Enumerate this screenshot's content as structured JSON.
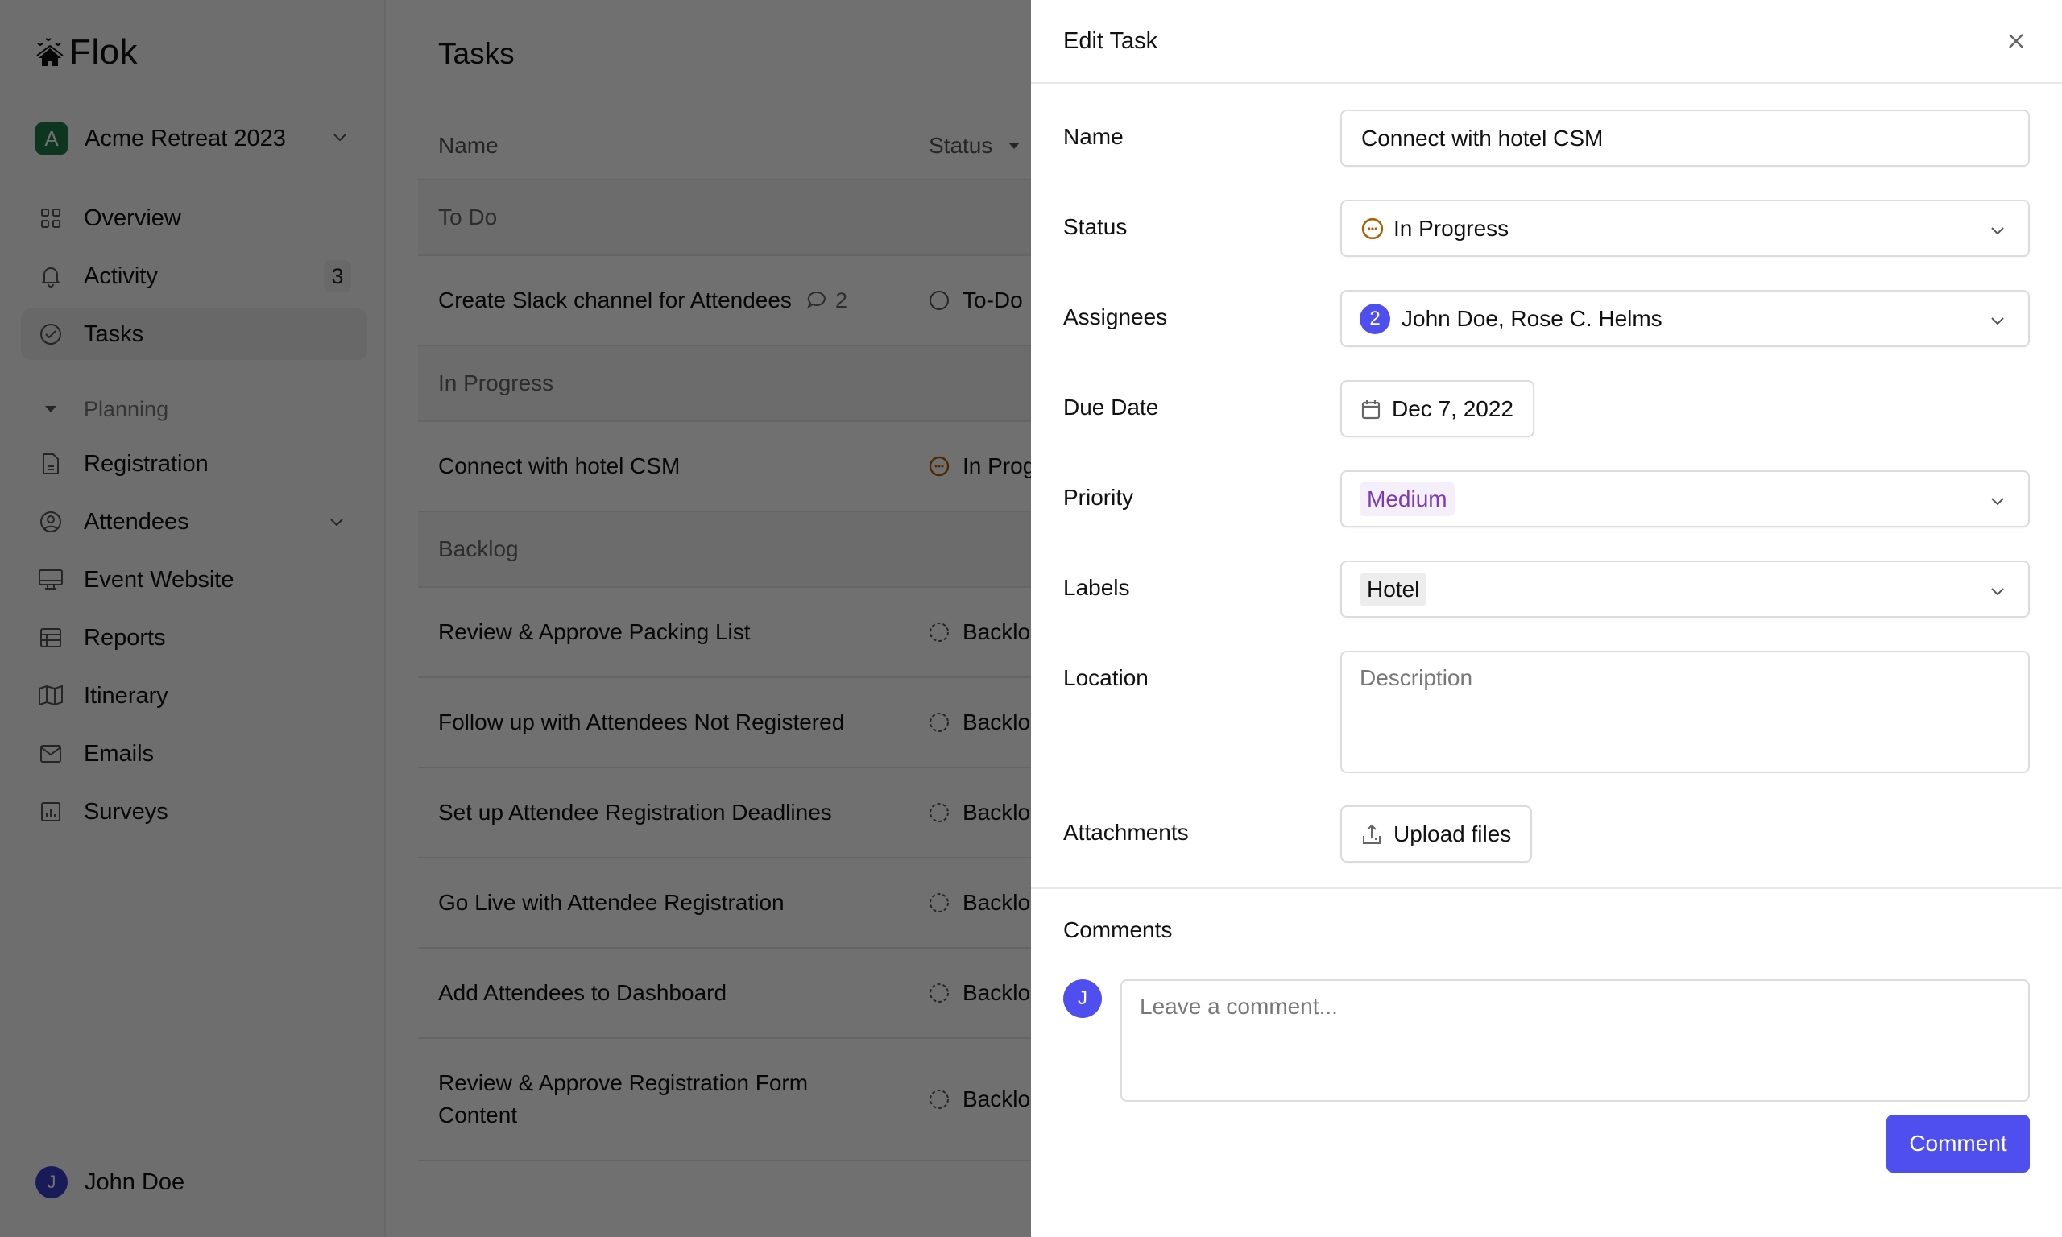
{
  "app": {
    "brand": "Flok",
    "workspace": {
      "initial": "A",
      "name": "Acme Retreat 2023",
      "color": "#1f7a4a"
    }
  },
  "sidebar": {
    "primary": [
      {
        "label": "Overview",
        "icon": "grid-icon"
      },
      {
        "label": "Activity",
        "icon": "bell-icon",
        "badge": "3"
      },
      {
        "label": "Tasks",
        "icon": "check-circle-icon",
        "active": true
      }
    ],
    "section": {
      "label": "Planning"
    },
    "planning": [
      {
        "label": "Registration",
        "icon": "document-icon"
      },
      {
        "label": "Attendees",
        "icon": "user-circle-icon",
        "expandable": true
      },
      {
        "label": "Event Website",
        "icon": "monitor-icon"
      },
      {
        "label": "Reports",
        "icon": "table-icon"
      },
      {
        "label": "Itinerary",
        "icon": "map-icon"
      },
      {
        "label": "Emails",
        "icon": "mail-icon"
      },
      {
        "label": "Surveys",
        "icon": "chart-icon"
      }
    ],
    "user": {
      "initial": "J",
      "name": "John Doe"
    }
  },
  "main": {
    "title": "Tasks",
    "columns": {
      "name": "Name",
      "status": "Status"
    },
    "groups": [
      {
        "label": "To Do",
        "tasks": [
          {
            "name": "Create Slack channel for Attendees",
            "comments": "2",
            "status": "To-Do",
            "status_icon": "circle-icon"
          }
        ]
      },
      {
        "label": "In Progress",
        "tasks": [
          {
            "name": "Connect with hotel CSM",
            "status": "In Progress",
            "status_icon": "in-progress-icon"
          }
        ]
      },
      {
        "label": "Backlog",
        "tasks": [
          {
            "name": "Review & Approve Packing List",
            "status": "Backlog",
            "status_icon": "dashed-circle-icon"
          },
          {
            "name": "Follow up with Attendees Not Registered",
            "status": "Backlog",
            "status_icon": "dashed-circle-icon"
          },
          {
            "name": "Set up Attendee Registration Deadlines",
            "status": "Backlog",
            "status_icon": "dashed-circle-icon"
          },
          {
            "name": "Go Live with Attendee Registration",
            "status": "Backlog",
            "status_icon": "dashed-circle-icon"
          },
          {
            "name": "Add Attendees to Dashboard",
            "status": "Backlog",
            "status_icon": "dashed-circle-icon"
          },
          {
            "name": "Review & Approve Registration Form Content",
            "status": "Backlog",
            "status_icon": "dashed-circle-icon"
          }
        ]
      }
    ]
  },
  "panel": {
    "title": "Edit Task",
    "fields": {
      "name": {
        "label": "Name",
        "value": "Connect with hotel CSM"
      },
      "status": {
        "label": "Status",
        "value": "In Progress",
        "color": "#b35c00"
      },
      "assignees": {
        "label": "Assignees",
        "count": "2",
        "value": "John Doe, Rose C. Helms"
      },
      "due_date": {
        "label": "Due Date",
        "value": "Dec 7, 2022"
      },
      "priority": {
        "label": "Priority",
        "value": "Medium",
        "color": "#7a3bb8"
      },
      "labels": {
        "label": "Labels",
        "value": "Hotel"
      },
      "location": {
        "label": "Location",
        "placeholder": "Description"
      },
      "attachments": {
        "label": "Attachments",
        "button": "Upload files"
      }
    },
    "comments": {
      "title": "Comments",
      "avatar_initial": "J",
      "placeholder": "Leave a comment...",
      "submit": "Comment",
      "accent": "#4f4ff0"
    }
  }
}
